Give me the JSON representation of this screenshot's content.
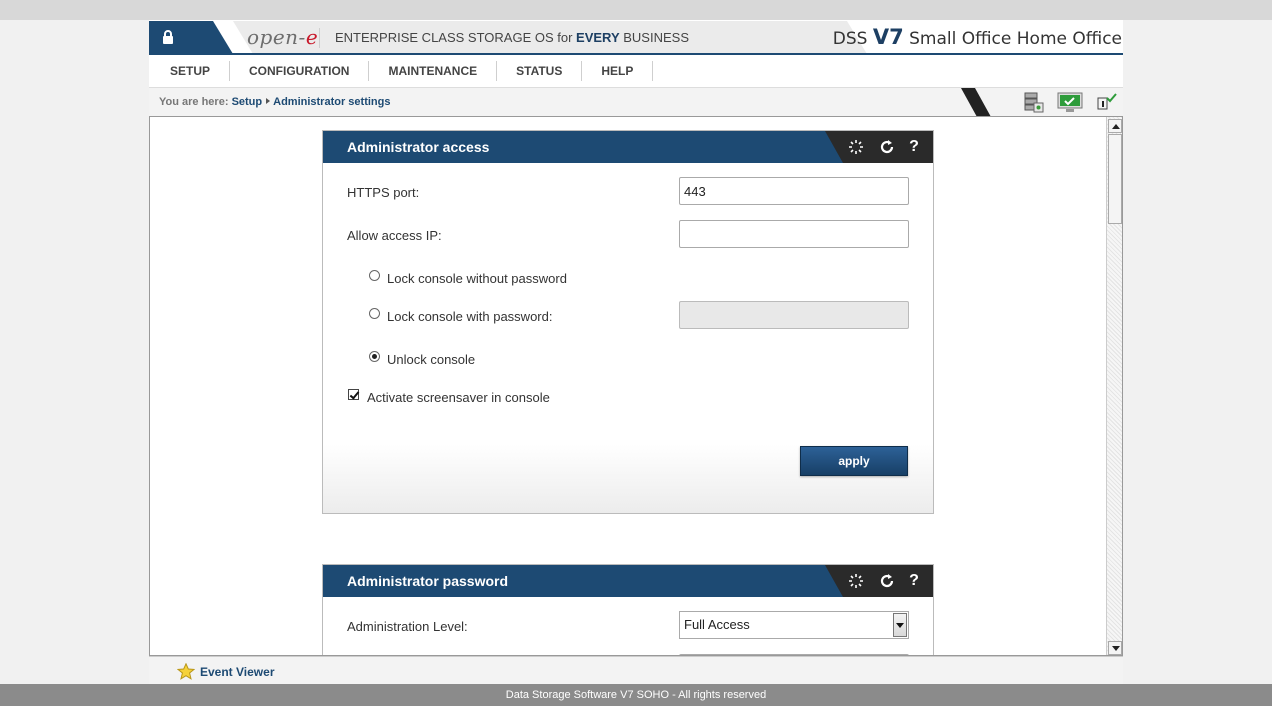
{
  "header": {
    "logo_text": "open-",
    "logo_e": "e",
    "tagline_pre": "ENTERPRISE CLASS STORAGE OS for ",
    "tagline_bold": "EVERY",
    "tagline_post": " BUSINESS",
    "product_pre": "DSS ",
    "product_version": "V7",
    "product_post": " Small Office Home Office"
  },
  "menu": {
    "items": [
      {
        "label": "SETUP"
      },
      {
        "label": "CONFIGURATION"
      },
      {
        "label": "MAINTENANCE"
      },
      {
        "label": "STATUS"
      },
      {
        "label": "HELP"
      }
    ]
  },
  "breadcrumb": {
    "prefix": "You are here:",
    "items": [
      "Setup",
      "Administrator settings"
    ]
  },
  "toolbar_icons": [
    "storage-icon",
    "monitor-icon",
    "info-check-icon"
  ],
  "access_panel": {
    "title": "Administrator access",
    "https_label": "HTTPS port:",
    "https_value": "443",
    "allow_ip_label": "Allow access IP:",
    "allow_ip_value": "",
    "radio_lock_nopass": "Lock console without password",
    "radio_lock_pass": "Lock console with password:",
    "radio_unlock": "Unlock console",
    "selected_radio": "Unlock console",
    "checkbox_screensaver": "Activate screensaver in console",
    "screensaver_checked": true,
    "apply_label": "apply"
  },
  "password_panel": {
    "title": "Administrator password",
    "level_label": "Administration Level:",
    "level_value": "Full Access"
  },
  "event_viewer": "Event Viewer",
  "footer": "Data Storage Software V7 SOHO - All rights reserved",
  "colors": {
    "brand_blue": "#1d4a73",
    "accent_red": "#c8182a",
    "footer_gray": "#8b8b8b"
  }
}
